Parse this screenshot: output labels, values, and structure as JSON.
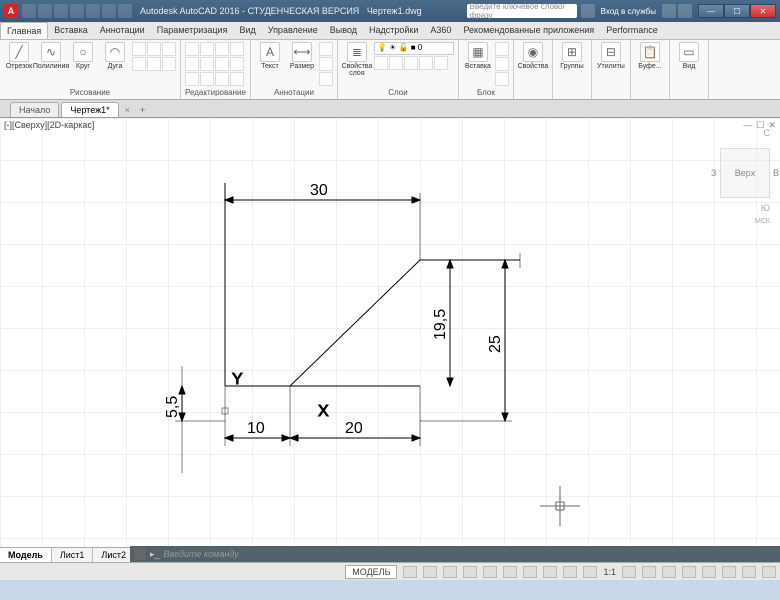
{
  "app": {
    "title": "Autodesk AutoCAD 2016 - СТУДЕНЧЕСКАЯ ВЕРСИЯ",
    "doc": "Чертеж1.dwg",
    "search_placeholder": "Введите ключевое слово/фразу",
    "login": "Вход в службы",
    "logo": "A"
  },
  "ribbon_tabs": [
    "Главная",
    "Вставка",
    "Аннотации",
    "Параметризация",
    "Вид",
    "Управление",
    "Вывод",
    "Надстройки",
    "A360",
    "Рекомендованные приложения",
    "Performance"
  ],
  "ribbon_active": 0,
  "panels": {
    "draw": {
      "label": "Рисование",
      "items": [
        "Отрезок",
        "Полилиния",
        "Круг",
        "Дуга"
      ]
    },
    "modify": {
      "label": "Редактирование"
    },
    "annot": {
      "label": "Аннотации",
      "text": "Текст",
      "dim": "Размер"
    },
    "layers": {
      "label": "Слои",
      "props": "Свойства слоя",
      "current": "0"
    },
    "block": {
      "label": "Блок",
      "insert": "Вставка"
    },
    "props": {
      "label": "Свойства"
    },
    "groups": {
      "label": "Группы"
    },
    "util": {
      "label": "Утилиты"
    },
    "clip": {
      "label": "Буфе..."
    },
    "view": {
      "label": "Вид"
    }
  },
  "doc_tabs": {
    "start": "Начало",
    "active": "Чертеж1*"
  },
  "viewport": {
    "label": "[-][Сверху][2D-каркас]"
  },
  "viewcube": {
    "top": "Верх",
    "s": "З",
    "e": "В",
    "n": "С",
    "south": "Ю",
    "wcs": "МСК"
  },
  "dimensions": {
    "d30": "30",
    "d10": "10",
    "d20": "20",
    "d55": "5,5",
    "d195": "19,5",
    "d25": "25"
  },
  "layout_tabs": [
    "Модель",
    "Лист1",
    "Лист2"
  ],
  "cmdline": {
    "prompt": "Введите команду"
  },
  "status": {
    "model": "МОДЕЛЬ",
    "scale": "1:1"
  }
}
